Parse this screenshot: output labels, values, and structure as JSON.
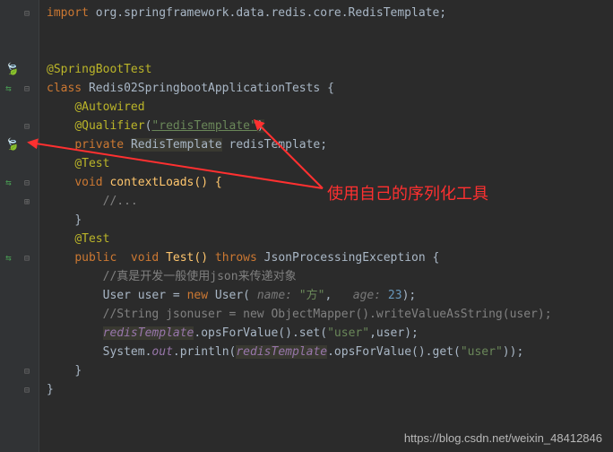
{
  "code": {
    "import_kw": "import",
    "import_pkg": " org.springframework.data.redis.core.RedisTemplate;",
    "anno_springboot": "@SpringBootTest",
    "class_kw": "class",
    "class_name": " Redis02SpringbootApplicationTests {",
    "anno_autowired": "@Autowired",
    "anno_qualifier": "@Qualifier",
    "qualifier_paren_open": "(",
    "qualifier_str": "\"redisTemplate\"",
    "qualifier_paren_close": ")",
    "private_kw": "private",
    "type_redistpl": "RedisTemplate",
    "field_redistpl": " redisTemplate;",
    "anno_test1": "@Test",
    "void_kw": "void",
    "method_context": " contextLoads() {",
    "comment_dots": "//...",
    "close_brace": "}",
    "anno_test2": "@Test",
    "public_kw": "public",
    "void_kw2": "  void",
    "method_test": " Test() ",
    "throws_kw": "throws",
    "exc_name": " JsonProcessingException {",
    "comment_json": "//真是开发一般使用json来传递对象",
    "user_type": "User ",
    "user_var": "user = ",
    "new_kw": "new",
    "user_ctor": " User( ",
    "hint_name": "name:",
    "str_fang": " \"方\"",
    "comma1": ",   ",
    "hint_age": "age:",
    "num_23": " 23",
    "ctor_close": ");",
    "comment_mapper": "//String jsonuser = new ObjectMapper().writeValueAsString(user);",
    "redistpl_call1": "redisTemplate",
    "opsfor1": ".opsForValue().set(",
    "str_user1": "\"user\"",
    "comma2": ",user);",
    "system": "System.",
    "out_fld": "out",
    "println": ".println(",
    "redistpl_call2": "redisTemplate",
    "opsfor2": ".opsForValue().get(",
    "str_user2": "\"user\"",
    "println_close": "));",
    "close_brace2": "}",
    "close_brace3": "}"
  },
  "annotation": {
    "text": "使用自己的序列化工具"
  },
  "watermark": "https://blog.csdn.net/weixin_48412846"
}
